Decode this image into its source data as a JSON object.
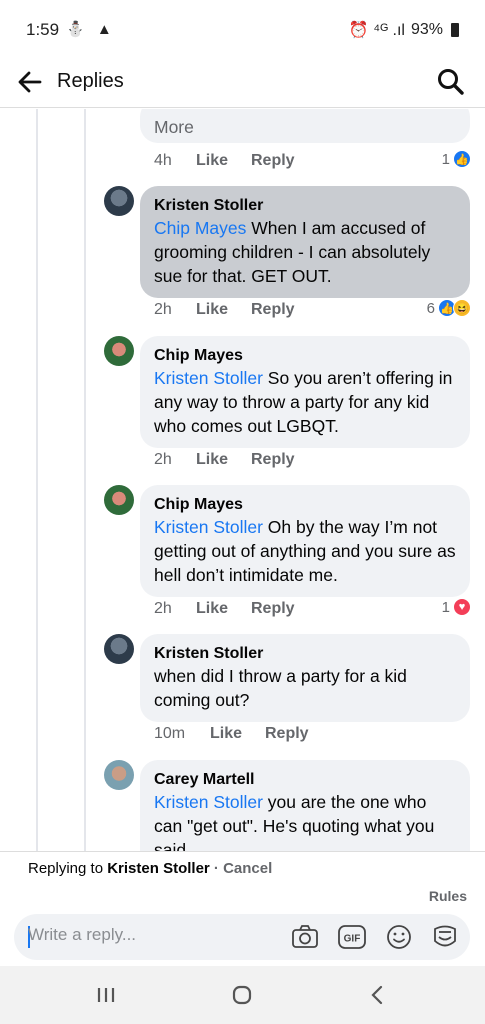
{
  "status_bar": {
    "time": "1:59",
    "left_icons": "⛄ ▲",
    "right_icons": "⏰ ⁴ᴳ .ıl",
    "battery": "93%"
  },
  "header": {
    "title": "Replies"
  },
  "comments": [
    {
      "body_tail": "More",
      "time": "4h",
      "like_label": "Like",
      "reply_label": "Reply",
      "reaction_count": "1"
    },
    {
      "author": "Kristen Stoller",
      "mention": "Chip Mayes",
      "text": " When I am accused of grooming children - I can absolutely sue for that. GET OUT.",
      "time": "2h",
      "like_label": "Like",
      "reply_label": "Reply",
      "reaction_count": "6"
    },
    {
      "author": "Chip Mayes",
      "mention": "Kristen Stoller",
      "text": "  So you aren’t offering in any way to throw a party for any kid who comes out LGBQT.",
      "time": "2h",
      "like_label": "Like",
      "reply_label": "Reply"
    },
    {
      "author": "Chip Mayes",
      "mention": "Kristen Stoller",
      "text": "  Oh by the way I’m not getting out of anything and you sure as hell don’t intimidate me.",
      "time": "2h",
      "like_label": "Like",
      "reply_label": "Reply",
      "reaction_count": "1"
    },
    {
      "author": "Kristen Stoller",
      "text": "when did I throw a party for a kid coming out?",
      "time": "10m",
      "like_label": "Like",
      "reply_label": "Reply"
    },
    {
      "author": "Carey Martell",
      "mention": "Kristen Stoller",
      "text": " you are the one who can \"get out\". He's quoting what you said"
    }
  ],
  "reply_bar": {
    "replying_prefix": "Replying to ",
    "replying_name": "Kristen Stoller",
    "separator": " · ",
    "cancel_label": "Cancel",
    "rules_label": "Rules",
    "placeholder": "Write a reply..."
  },
  "colors": {
    "accent": "#1877f2",
    "bubble": "#f0f2f5",
    "bubble_highlight": "#c9ccd1",
    "muted": "#65676b"
  },
  "icons": [
    "back-arrow-icon",
    "search-icon",
    "camera-icon",
    "gif-icon",
    "emoji-icon",
    "sticker-icon",
    "recents-icon",
    "home-icon",
    "back-icon"
  ]
}
